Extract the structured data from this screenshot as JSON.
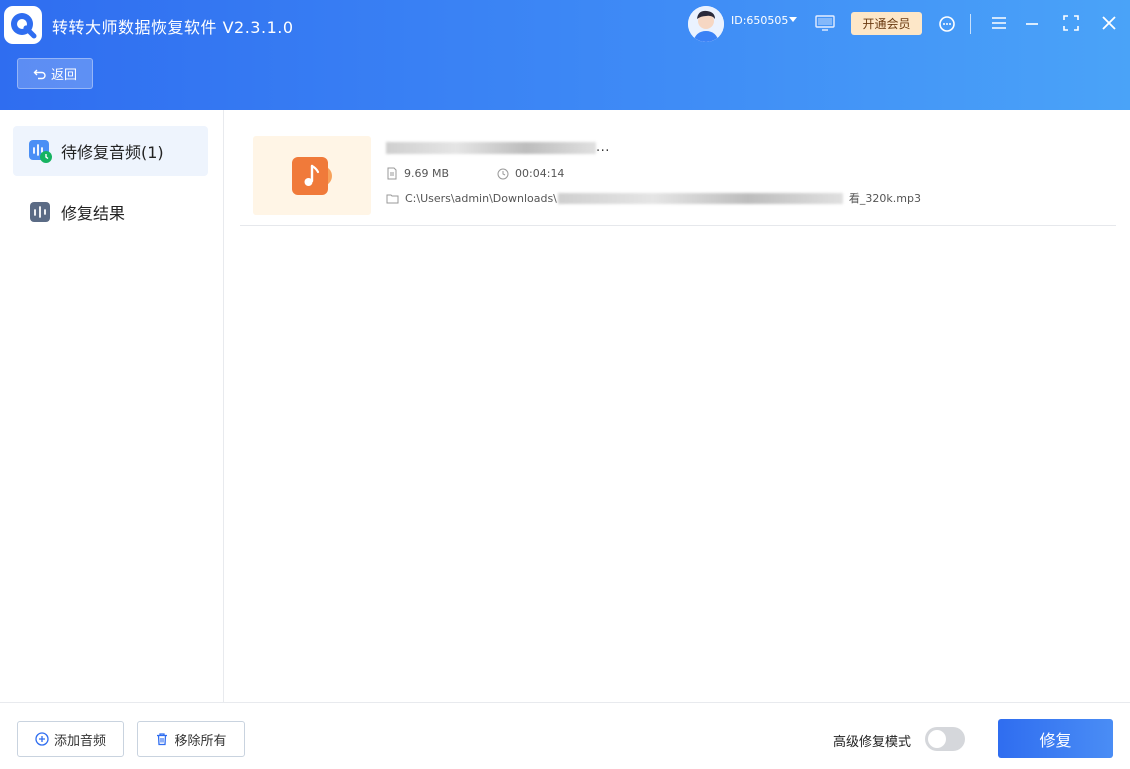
{
  "app": {
    "title": "转转大师数据恢复软件 V2.3.1.0",
    "back_label": "返回",
    "user_id": "ID:650505",
    "vip_label": "开通会员"
  },
  "sidebar": {
    "items": [
      {
        "label": "待修复音频(1)",
        "active": true
      },
      {
        "label": "修复结果",
        "active": false
      }
    ]
  },
  "files": [
    {
      "size": "9.69 MB",
      "duration": "00:04:14",
      "path_prefix": "C:\\Users\\admin\\Downloads\\",
      "path_suffix": "看_320k.mp3",
      "name_suffix": "..."
    }
  ],
  "footer": {
    "add_label": "添加音频",
    "remove_label": "移除所有",
    "advanced_label": "高级修复模式",
    "advanced_enabled": false,
    "repair_label": "修复"
  },
  "colors": {
    "primary": "#2f6df0",
    "vip_bg": "#fde7c8",
    "thumb_bg": "#fff5e6",
    "music_orange": "#f07a3a"
  }
}
